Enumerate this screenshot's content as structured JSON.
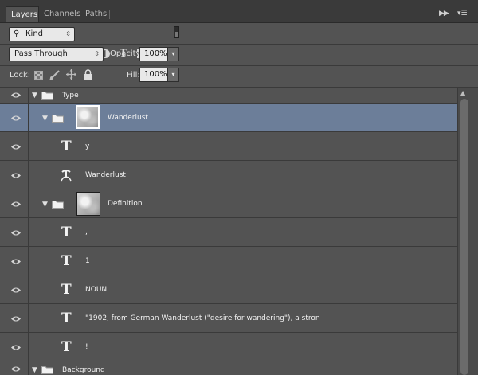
{
  "tabs": [
    {
      "label": "Layers",
      "active": true
    },
    {
      "label": "Channels",
      "active": false
    },
    {
      "label": "Paths",
      "active": false
    }
  ],
  "panel_controls": {
    "collapse_icon": "double-chevron-right-icon",
    "menu_icon": "panel-menu-icon"
  },
  "filter": {
    "kind_label": "Kind",
    "icons": [
      "pixel-filter-icon",
      "adjustment-filter-icon",
      "type-filter-icon",
      "shape-filter-icon",
      "smart-object-filter-icon",
      "filter-toggle-icon"
    ]
  },
  "blend": {
    "mode": "Pass Through",
    "opacity_label": "Opacity:",
    "opacity_value": "100%"
  },
  "lock": {
    "label": "Lock:",
    "icons": [
      "lock-transparent-icon",
      "lock-image-icon",
      "lock-position-icon",
      "lock-all-icon"
    ],
    "fill_label": "Fill:",
    "fill_value": "100%"
  },
  "layers": [
    {
      "name": "Type",
      "kind": "group",
      "indent": 0,
      "expanded": true,
      "selected": false
    },
    {
      "name": "Wanderlust",
      "kind": "group-thumb",
      "indent": 1,
      "expanded": true,
      "selected": true
    },
    {
      "name": "y",
      "kind": "text",
      "indent": 2,
      "selected": false
    },
    {
      "name": "Wanderlust",
      "kind": "warp-text",
      "indent": 2,
      "selected": false
    },
    {
      "name": "Definition",
      "kind": "group-thumb",
      "indent": 1,
      "expanded": true,
      "selected": false
    },
    {
      "name": ",",
      "kind": "text",
      "indent": 2,
      "selected": false
    },
    {
      "name": "1",
      "kind": "text",
      "indent": 2,
      "selected": false
    },
    {
      "name": "NOUN",
      "kind": "text",
      "indent": 2,
      "selected": false
    },
    {
      "name": "\"1902, from German Wanderlust (\"desire for wandering\"), a stron",
      "kind": "text",
      "indent": 2,
      "selected": false
    },
    {
      "name": "!",
      "kind": "text",
      "indent": 2,
      "selected": false
    },
    {
      "name": "Background",
      "kind": "group",
      "indent": 0,
      "expanded": true,
      "selected": false
    }
  ],
  "colors": {
    "panel": "#535353",
    "selection": "#6c7e99",
    "divider": "#3a3a3a"
  }
}
